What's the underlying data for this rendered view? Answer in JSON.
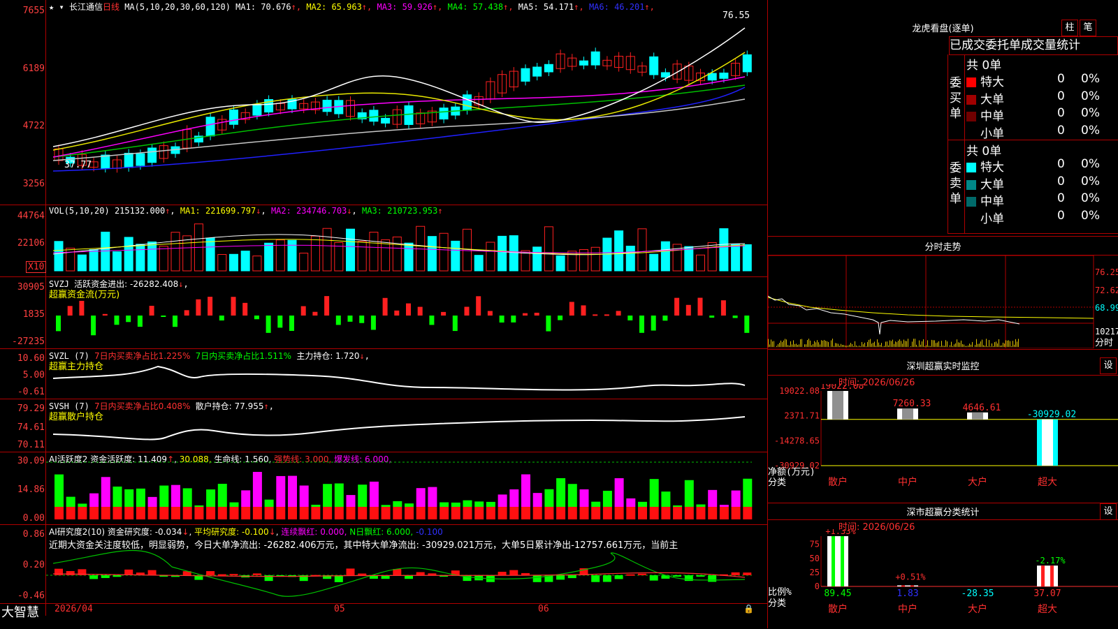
{
  "stock": {
    "name": "长江通信",
    "period": "日线",
    "ma_header": "MA(5,10,20,30,60,120)",
    "ma_items": [
      {
        "label": "MA1: 70.676",
        "color": "#ffffff"
      },
      {
        "label": "MA2: 65.963",
        "color": "#ffff00"
      },
      {
        "label": "MA3: 59.926",
        "color": "#ff00ff"
      },
      {
        "label": "MA4: 57.438",
        "color": "#00ff00"
      },
      {
        "label": "MA5: 54.171",
        "color": "#ffffff"
      },
      {
        "label": "MA6: 46.201",
        "color": "#3030ff"
      }
    ],
    "price_axis": [
      "7655",
      "6189",
      "4722",
      "3256"
    ],
    "high_note": "76.55",
    "low_note": "37.77"
  },
  "vol": {
    "header": "VOL(5,10,20)",
    "value": "215132.000",
    "ma1": "MA1: 221699.797",
    "ma2": "MA2: 234746.703",
    "ma3": "MA3: 210723.953",
    "axis": [
      "44764",
      "22106"
    ],
    "unit": "X10"
  },
  "svzj": {
    "name": "SVZJ",
    "label": "活跃资金进出: -26282.408",
    "subtitle": "超赢资金流(万元)",
    "axis": [
      "30905",
      "1835",
      "-27235"
    ]
  },
  "svzl": {
    "name": "SVZL (7)",
    "a": "7日内买卖净占比1.225%",
    "b": "7日内买卖净占比1.511%",
    "c": "主力持仓: 1.720",
    "subtitle": "超赢主力持仓",
    "axis": [
      "10.60",
      "5.00",
      "-0.61"
    ]
  },
  "svsh": {
    "name": "SVSH (7)",
    "a": "7日内买卖净占比0.408%",
    "b": "散户持仓: 77.955",
    "subtitle": "超赢散户持仓",
    "axis": [
      "79.29",
      "74.61",
      "70.11"
    ]
  },
  "ai1": {
    "name": "AI活跃度2",
    "a": "资金活跃度: 11.409",
    "b": "30.088,",
    "c": "生命线: 1.560,",
    "d": "强势线: 3.000,",
    "e": "爆发线: 6.000,",
    "axis": [
      "30.09",
      "14.86",
      "0.00"
    ]
  },
  "ai2": {
    "name": "AI研究度2(10)",
    "a": "资金研究度: -0.034",
    "b": "平均研究度: -0.100",
    "c": "连续飘红: 0.000,",
    "d": "N日飘红: 6.000,",
    "e": "-0.100",
    "text": "近期大资金关注度较低，明显弱势，今日大单净流出: -26282.406万元，其中特大单净流出: -30929.021万元，大单5日累计净出-12757.661万元，当前主",
    "axis": [
      "0.86",
      "0.20",
      "-0.46"
    ]
  },
  "footer": {
    "brand": "大智慧",
    "date0": "2026/04",
    "m05": "05",
    "m06": "06"
  },
  "lhb": {
    "title": "龙虎看盘(逐单)",
    "btn1": "柱",
    "btn2": "笔",
    "tabs": "已成交委托单成交量统计",
    "buy_label": "委买单",
    "sell_label": "委卖单",
    "buy_total": "共 0单",
    "sell_total": "共 0单",
    "buy_rows": [
      {
        "name": "特大",
        "val": "0",
        "pct": "0%",
        "color": "#ff0000"
      },
      {
        "name": "大单",
        "val": "0",
        "pct": "0%",
        "color": "#a00000"
      },
      {
        "name": "中单",
        "val": "0",
        "pct": "0%",
        "color": "#700000"
      },
      {
        "name": "小单",
        "val": "0",
        "pct": "0%",
        "color": "#000000"
      }
    ],
    "sell_rows": [
      {
        "name": "特大",
        "val": "0",
        "pct": "0%",
        "color": "#00ffff"
      },
      {
        "name": "大单",
        "val": "0",
        "pct": "0%",
        "color": "#008888"
      },
      {
        "name": "中单",
        "val": "0",
        "pct": "0%",
        "color": "#006a6a"
      },
      {
        "name": "小单",
        "val": "0",
        "pct": "0%",
        "color": "#000000"
      }
    ]
  },
  "intraday": {
    "title": "分时走势",
    "axis": [
      "76.25",
      "72.62",
      "68.99",
      "10217"
    ],
    "unit": "分时"
  },
  "monitor": {
    "title": "深圳超赢实时监控",
    "btn": "设",
    "time": "时间: 2026/06/26",
    "axis": [
      "19022.08",
      "2371.71",
      "-14278.65",
      "-30929.02"
    ],
    "bars": [
      {
        "cat": "散户",
        "value": 19022.08,
        "label": "19022.08"
      },
      {
        "cat": "中户",
        "value": 7260.33,
        "label": "7260.33"
      },
      {
        "cat": "大户",
        "value": 4646.61,
        "label": "4646.61"
      },
      {
        "cat": "超大",
        "value": -30929.02,
        "label": "-30929.02"
      }
    ],
    "ylabel1": "净额(万元)",
    "ylabel2": "分类"
  },
  "stats": {
    "title": "深市超赢分类统计",
    "btn": "设",
    "time": "时间: 2026/06/26",
    "axis": [
      "75",
      "50",
      "25",
      "0"
    ],
    "bars": [
      {
        "cat": "散户",
        "value": 89.45,
        "label": "89.45",
        "top": "+1.33%"
      },
      {
        "cat": "中户",
        "value": 1.83,
        "label": "1.83",
        "top": "+0.51%"
      },
      {
        "cat": "大户",
        "value": -28.35,
        "label": "-28.35",
        "top": ""
      },
      {
        "cat": "超大",
        "value": 37.07,
        "label": "37.07",
        "top": "-2.17%"
      }
    ],
    "ylabel1": "比例%",
    "ylabel2": "分类"
  }
}
